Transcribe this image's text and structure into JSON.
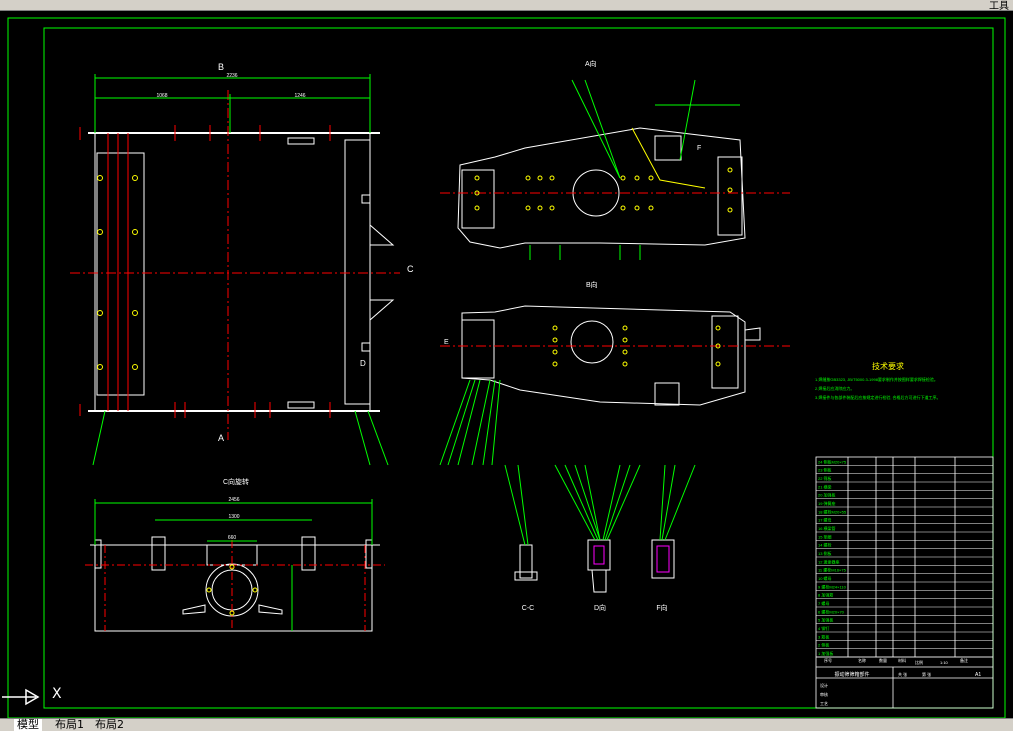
{
  "toolbar": {
    "right_label": "工具"
  },
  "tabs": [
    {
      "label": "模型"
    },
    {
      "label": "布局1"
    },
    {
      "label": "布局2"
    }
  ],
  "colors": {
    "background": "#000000",
    "frame": "#00ff00",
    "center_line": "#ff0000",
    "part_line": "#ffffff",
    "leader": "#00ff00",
    "yellow": "#ffff00",
    "magenta": "#ff00ff"
  },
  "views": {
    "front_label_top": "B",
    "front_label_bottom": "A",
    "front_label_side_c": "C",
    "front_label_side_d": "D",
    "front_dim_total": "2236",
    "front_dim_left": "1068",
    "front_dim_right": "1246",
    "view_a_title": "A向",
    "view_b_title": "B向",
    "view_c_title": "C向旋转",
    "view_cc": "C-C",
    "view_d": "D向",
    "view_f": "F向",
    "label_f": "F",
    "label_e": "E",
    "c_dim_total": "2456",
    "c_dim_inner": "1300",
    "c_dim_center": "660"
  },
  "tech": {
    "title": "技术要求",
    "lines": [
      "1.焊缝按GB3323, JB/T5000.3-1998要求制作并按图样要求焊接检验。",
      "2.焊接后应消除应力。",
      "3.焊接件与各部件装配后应按规定进行检验, 合格后方可进行下道工序。"
    ]
  },
  "title_block": {
    "header": [
      "序号",
      "名称",
      "数量",
      "材料",
      "备注"
    ],
    "drawing_name": "振动筛筛箱部件",
    "scale_label": "比例",
    "scale_value": "1:10",
    "sheet_label": "共 张",
    "sheet_value": "第 张",
    "size_value": "A1",
    "roles": [
      "设计",
      "审核",
      "工艺"
    ]
  },
  "parts": [
    "24 侧板M20×75",
    "23 侧板",
    "22 筛板",
    "21 横梁",
    "20 加强板",
    "19 弹簧座",
    "18 螺栓M20×55",
    "17 螺母",
    "16 横梁管",
    "15 垫圈",
    "14 螺栓",
    "13 侧板",
    "12 激振器座",
    "11 螺栓M16×75",
    "10 螺母",
    "9 螺栓M24×110",
    "8 加强筋",
    "7 螺母",
    "6 螺栓M20×70",
    "5 加强板",
    "4 铆钉",
    "3 筋板",
    "2 侧板",
    "1 加强板"
  ]
}
